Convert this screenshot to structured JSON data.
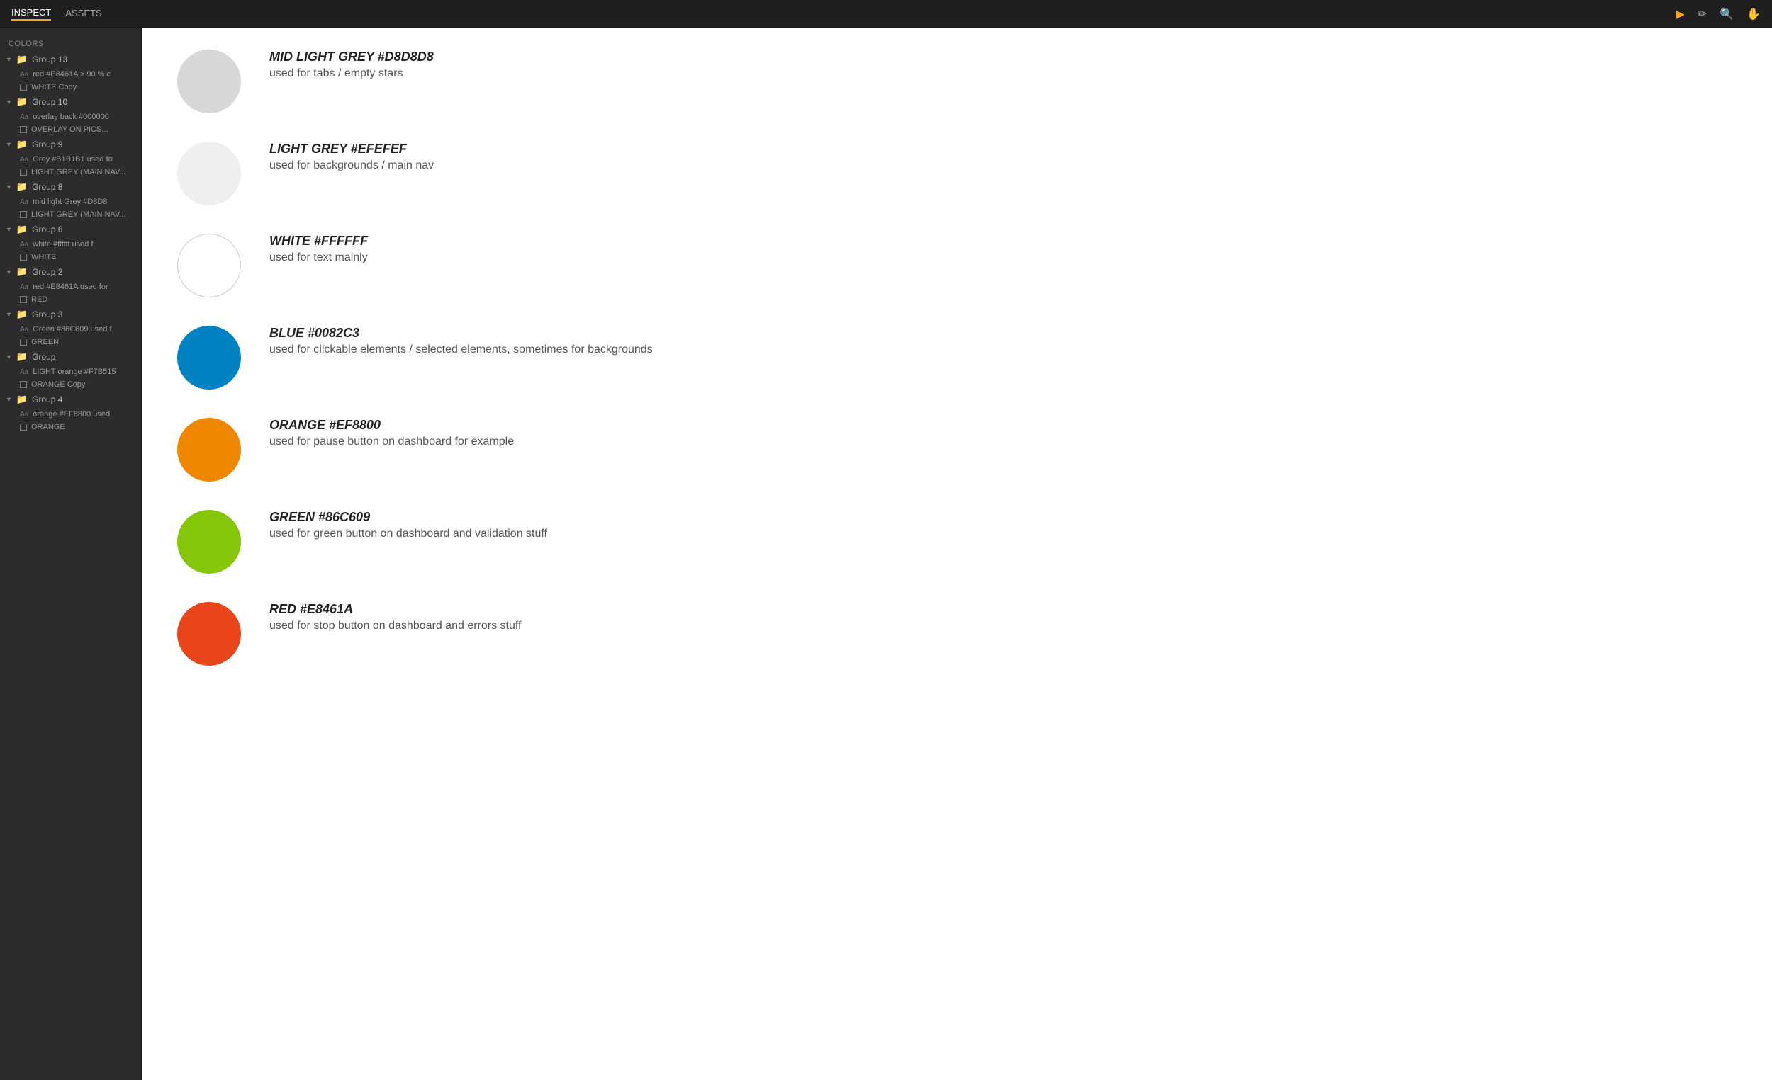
{
  "topbar": {
    "tabs": [
      {
        "id": "inspect",
        "label": "INSPECT",
        "active": true
      },
      {
        "id": "assets",
        "label": "ASSETS",
        "active": false
      }
    ],
    "icons": [
      {
        "id": "pointer-icon",
        "symbol": "▶",
        "active": true
      },
      {
        "id": "pen-icon",
        "symbol": "✏",
        "active": false
      },
      {
        "id": "search-icon",
        "symbol": "🔍",
        "active": false
      },
      {
        "id": "hand-icon",
        "symbol": "✋",
        "active": false
      }
    ]
  },
  "sidebar": {
    "section_title": "COLORS",
    "groups": [
      {
        "id": "group-13",
        "label": "Group 13",
        "expanded": true,
        "children": [
          {
            "type": "text",
            "label": "red #E8461A > 90 % c"
          },
          {
            "type": "rect",
            "label": "WHITE Copy"
          }
        ]
      },
      {
        "id": "group-10",
        "label": "Group 10",
        "expanded": true,
        "children": [
          {
            "type": "text",
            "label": "overlay back #000000"
          },
          {
            "type": "rect",
            "label": "OVERLAY ON PICS..."
          }
        ]
      },
      {
        "id": "group-9",
        "label": "Group 9",
        "expanded": true,
        "children": [
          {
            "type": "text",
            "label": "Grey #B1B1B1 used fo"
          },
          {
            "type": "rect",
            "label": "LIGHT GREY (MAIN NAV..."
          }
        ]
      },
      {
        "id": "group-8",
        "label": "Group 8",
        "expanded": true,
        "children": [
          {
            "type": "text",
            "label": "mid light Grey #D8D8"
          },
          {
            "type": "rect",
            "label": "LIGHT GREY (MAIN NAV..."
          }
        ]
      },
      {
        "id": "group-6",
        "label": "Group 6",
        "expanded": true,
        "children": [
          {
            "type": "text",
            "label": "white #ffffff used f"
          },
          {
            "type": "rect",
            "label": "WHITE"
          }
        ]
      },
      {
        "id": "group-2",
        "label": "Group 2",
        "expanded": true,
        "children": [
          {
            "type": "text",
            "label": "red #E8461A used for"
          },
          {
            "type": "rect",
            "label": "RED"
          }
        ]
      },
      {
        "id": "group-3",
        "label": "Group 3",
        "expanded": true,
        "children": [
          {
            "type": "text",
            "label": "Green #86C609 used f"
          },
          {
            "type": "rect",
            "label": "GREEN"
          }
        ]
      },
      {
        "id": "group",
        "label": "Group",
        "expanded": true,
        "children": [
          {
            "type": "text",
            "label": "LIGHT orange #F7B515"
          },
          {
            "type": "rect",
            "label": "ORANGE Copy"
          }
        ]
      },
      {
        "id": "group-4",
        "label": "Group 4",
        "expanded": true,
        "children": [
          {
            "type": "text",
            "label": "orange #EF8800 used"
          },
          {
            "type": "rect",
            "label": "ORANGE"
          }
        ]
      }
    ]
  },
  "content": {
    "colors": [
      {
        "id": "mid-light-grey",
        "name": "MID LIGHT GREY #D8D8D8",
        "desc": "used for tabs / empty stars",
        "hex": "#D8D8D8",
        "bordered": false
      },
      {
        "id": "light-grey",
        "name": "LIGHT GREY #EFEFEF",
        "desc": "used for backgrounds / main nav",
        "hex": "#EFEFEF",
        "bordered": false
      },
      {
        "id": "white",
        "name": "WHITE #FFFFFF",
        "desc": "used for text mainly",
        "hex": "#FFFFFF",
        "bordered": true
      },
      {
        "id": "blue",
        "name": "BLUE #0082C3",
        "desc": "used for clickable elements / selected elements, sometimes for backgrounds",
        "hex": "#0082C3",
        "bordered": false
      },
      {
        "id": "orange",
        "name": "ORANGE #EF8800",
        "desc": "used for pause button on dashboard for example",
        "hex": "#EF8800",
        "bordered": false
      },
      {
        "id": "green",
        "name": "GREEN #86C609",
        "desc": "used for green button on dashboard and validation stuff",
        "hex": "#86C609",
        "bordered": false
      },
      {
        "id": "red",
        "name": "RED #E8461A",
        "desc": "used for stop button on dashboard and errors stuff",
        "hex": "#E8461A",
        "bordered": false
      }
    ]
  }
}
